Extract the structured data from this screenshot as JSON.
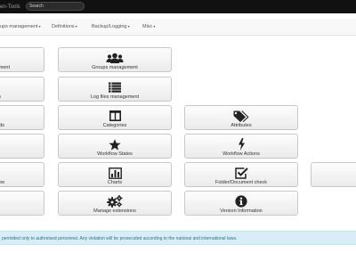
{
  "header": {
    "brand_text": "en-Tools",
    "search_placeholder": "Search"
  },
  "nav": {
    "groups_management": "ups management",
    "definitions": "Definitions",
    "backup_logging": "Backup/Logging",
    "misc": "Misc",
    "caret": "▾"
  },
  "tiles": {
    "user_management": "ment",
    "groups_management": "Groups management",
    "column1_row2": "s",
    "log_files_management": "Log files management",
    "keywords": "rds",
    "categories": "Categories",
    "attributes": "Attributes",
    "workflow_states": "Workflow States",
    "workflow_actions": "Workflow Actions",
    "column1_row5": "ew",
    "charts": "Charts",
    "folder_document_check": "Folder/Document check",
    "manage_extensions": "Manage extensions",
    "version_information": "Version Information"
  },
  "footer": {
    "notice": "permitted only to authorised personnel. Any violation will be prosecuted according to the national and international laws."
  },
  "colors": {
    "topbar": "#111111",
    "navbar": "#f8f8f8",
    "icon": "#222222",
    "notice_bg": "#d9edf7",
    "notice_text": "#31708f"
  }
}
